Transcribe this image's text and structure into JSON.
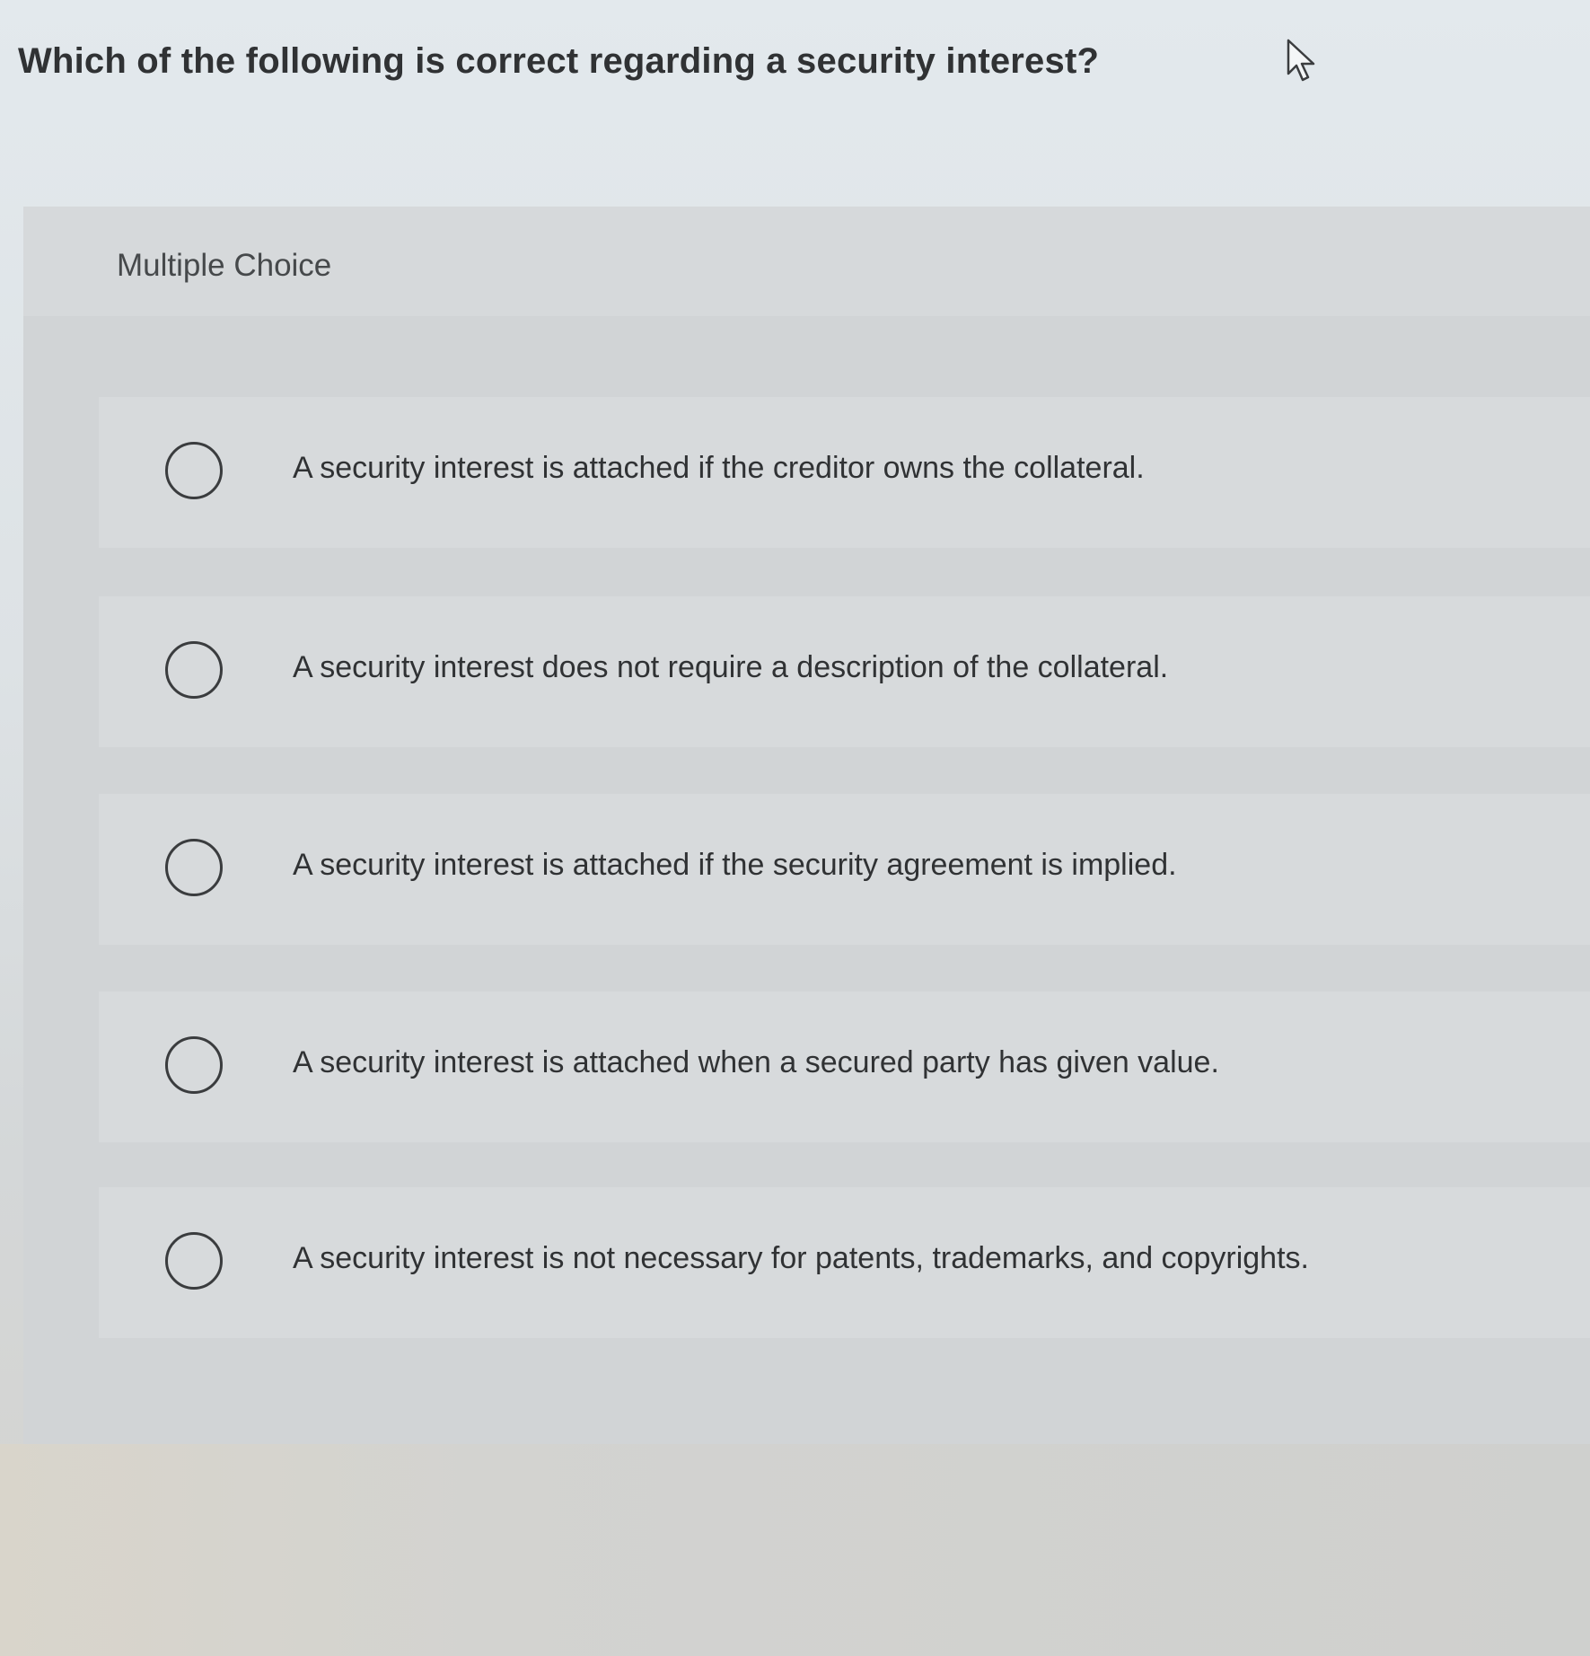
{
  "question": {
    "text": "Which of the following is correct regarding a security interest?"
  },
  "panel": {
    "label": "Multiple Choice"
  },
  "options": [
    {
      "text": "A security interest is attached if the creditor owns the collateral.",
      "selected": false
    },
    {
      "text": "A security interest does not require a description of the collateral.",
      "selected": false
    },
    {
      "text": "A security interest is attached if the security agreement is implied.",
      "selected": false
    },
    {
      "text": "A security interest is attached when a secured party has given value.",
      "selected": false
    },
    {
      "text": "A security interest is not necessary for patents, trademarks, and copyrights.",
      "selected": false
    }
  ],
  "icons": {
    "cursor": "pointer-cursor-icon",
    "radio": "radio-unselected-icon"
  }
}
